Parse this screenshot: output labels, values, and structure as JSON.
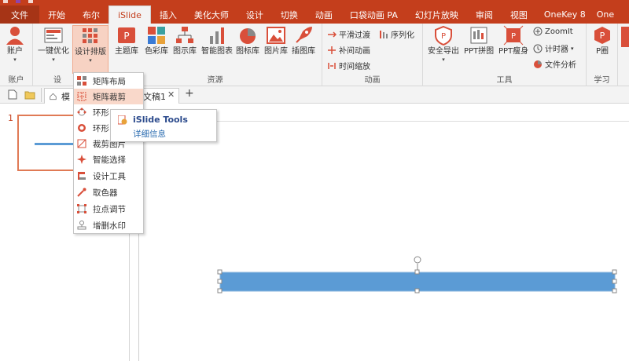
{
  "colors": {
    "accent": "#c43e1c",
    "accent_dark": "#a63416",
    "highlight": "#f7d2c3",
    "shape_fill": "#5b9bd5"
  },
  "tabs": [
    {
      "label": "文件"
    },
    {
      "label": "开始"
    },
    {
      "label": "布尔"
    },
    {
      "label": "iSlide"
    },
    {
      "label": "插入"
    },
    {
      "label": "美化大师"
    },
    {
      "label": "设计"
    },
    {
      "label": "切换"
    },
    {
      "label": "动画"
    },
    {
      "label": "口袋动画 PA"
    },
    {
      "label": "幻灯片放映"
    },
    {
      "label": "审阅"
    },
    {
      "label": "视图"
    },
    {
      "label": "OneKey 8"
    },
    {
      "label": "One"
    }
  ],
  "ribbon": {
    "account": {
      "label": "账户",
      "group": "账户"
    },
    "optimize": {
      "label": "一键优化"
    },
    "layout": {
      "label": "设计排版",
      "group": "设"
    },
    "resources": {
      "group": "资源",
      "items": [
        {
          "label": "主题库"
        },
        {
          "label": "色彩库"
        },
        {
          "label": "图示库"
        },
        {
          "label": "智能图表"
        },
        {
          "label": "图标库"
        },
        {
          "label": "图片库"
        },
        {
          "label": "插图库"
        }
      ]
    },
    "animation": {
      "group": "动画",
      "smooth": "平滑过渡",
      "tween": "补间动画",
      "timescale": "时间缩放",
      "sequence": "序列化"
    },
    "tools": {
      "group": "工具",
      "safe_export": "安全导出",
      "ppt_stitch": "PPT拼图",
      "ppt_slim": "PPT瘦身",
      "zoomit": "ZoomIt",
      "timer": "计时器",
      "file_analysis": "文件分析"
    },
    "learn": {
      "label": "P圈",
      "group": "学习"
    }
  },
  "doc_tabs": {
    "model": "模",
    "doc": "文稿1",
    "close": "✕",
    "add": "+"
  },
  "slide_number": "1",
  "menu": {
    "items": [
      {
        "label": "矩阵布局"
      },
      {
        "label": "矩阵裁剪"
      },
      {
        "label": "环形"
      },
      {
        "label": "环形"
      },
      {
        "label": "裁剪图片"
      },
      {
        "label": "智能选择"
      },
      {
        "label": "设计工具"
      },
      {
        "label": "取色器"
      },
      {
        "label": "拉点调节"
      },
      {
        "label": "增删水印"
      }
    ]
  },
  "tooltip": {
    "title": "iSlide Tools",
    "link": "详细信息"
  }
}
